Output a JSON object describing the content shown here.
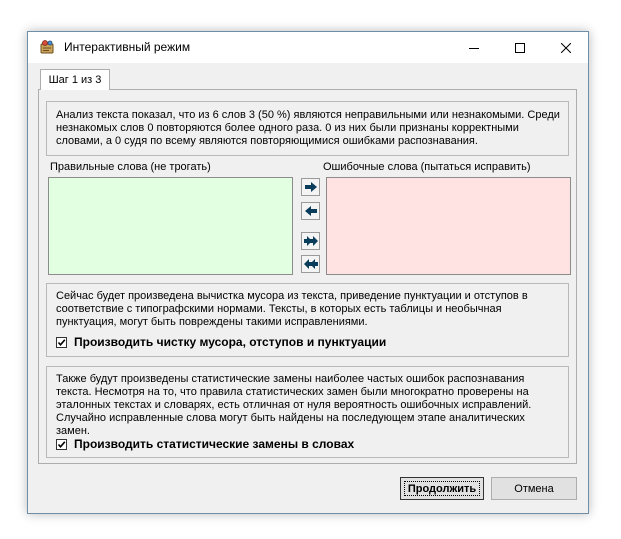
{
  "window": {
    "title": "Интерактивный режим",
    "icons": {
      "app": "app-icon",
      "minimize": "minimize-icon",
      "maximize": "maximize-icon",
      "close": "close-icon"
    }
  },
  "tab": {
    "label": "Шаг 1 из 3"
  },
  "analysis": {
    "text": "Анализ текста показал, что из 6 слов 3 (50 %) являются неправильными или незнакомыми. Среди незнакомых слов 0 повторяются более одного раза. 0 из них были признаны корректными словами, а 0 судя по всему являются повторяющимися ошибками распознавания."
  },
  "lists": {
    "correct_label": "Правильные слова (не трогать)",
    "wrong_label": "Ошибочные слова (пытаться исправить)",
    "correct_items": [],
    "wrong_items": [],
    "colors": {
      "correct_bg": "#e2ffe2",
      "wrong_bg": "#ffe2e2",
      "arrow": "#0a3d5c"
    },
    "arrow_icons": [
      "arrow-right-icon",
      "arrow-left-icon",
      "double-arrow-right-icon",
      "double-arrow-left-icon"
    ]
  },
  "cleanup": {
    "text": "Сейчас будет произведена вычистка мусора из текста, приведение пунктуации и отступов в соответствие с типографскими нормами. Тексты, в которых есть таблицы и необычная пунктуация, могут быть повреждены такими исправлениями.",
    "checkbox_label": "Производить чистку мусора, отступов и пунктуации",
    "checked": true
  },
  "stats": {
    "text": "Также будут произведены статистические замены наиболее частых ошибок распознавания текста. Несмотря на то, что правила статистических замен были многократно проверены на эталонных текстах и словарях, есть отличная от нуля вероятность ошибочных исправлений. Случайно исправленные слова могут быть найдены на последующем этапе аналитических замен.",
    "checkbox_label": "Производить статистические замены в словах",
    "checked": true
  },
  "buttons": {
    "continue": "Продолжить",
    "cancel": "Отмена"
  }
}
